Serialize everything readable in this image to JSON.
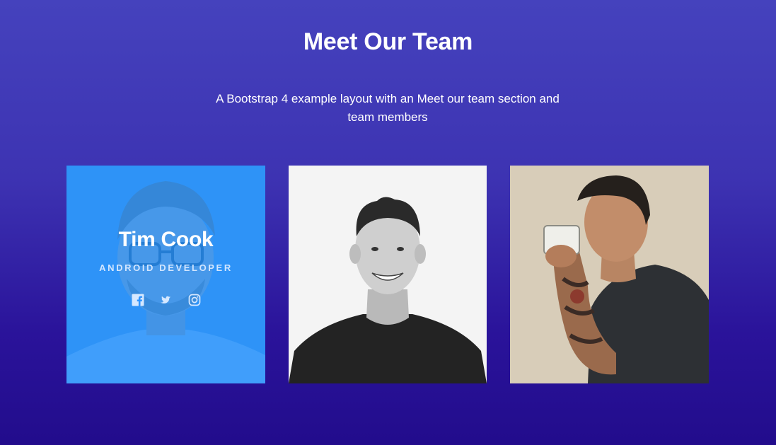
{
  "section": {
    "title": "Meet Our Team",
    "subtitle": "A Bootstrap 4 example layout with an Meet our team section and team members"
  },
  "members": [
    {
      "name": "Tim Cook",
      "role": "ANDROID DEVELOPER",
      "socials": [
        "facebook-icon",
        "twitter-icon",
        "instagram-icon"
      ],
      "overlay_color": "#1e90ff"
    },
    {
      "photo": "smiling-man-black-white-photo"
    },
    {
      "photo": "tattooed-man-drinking-photo"
    }
  ],
  "colors": {
    "background_top": "#4542bd",
    "background_bottom": "#220c8c",
    "text": "#ffffff",
    "card_overlay": "#2f95ff"
  }
}
